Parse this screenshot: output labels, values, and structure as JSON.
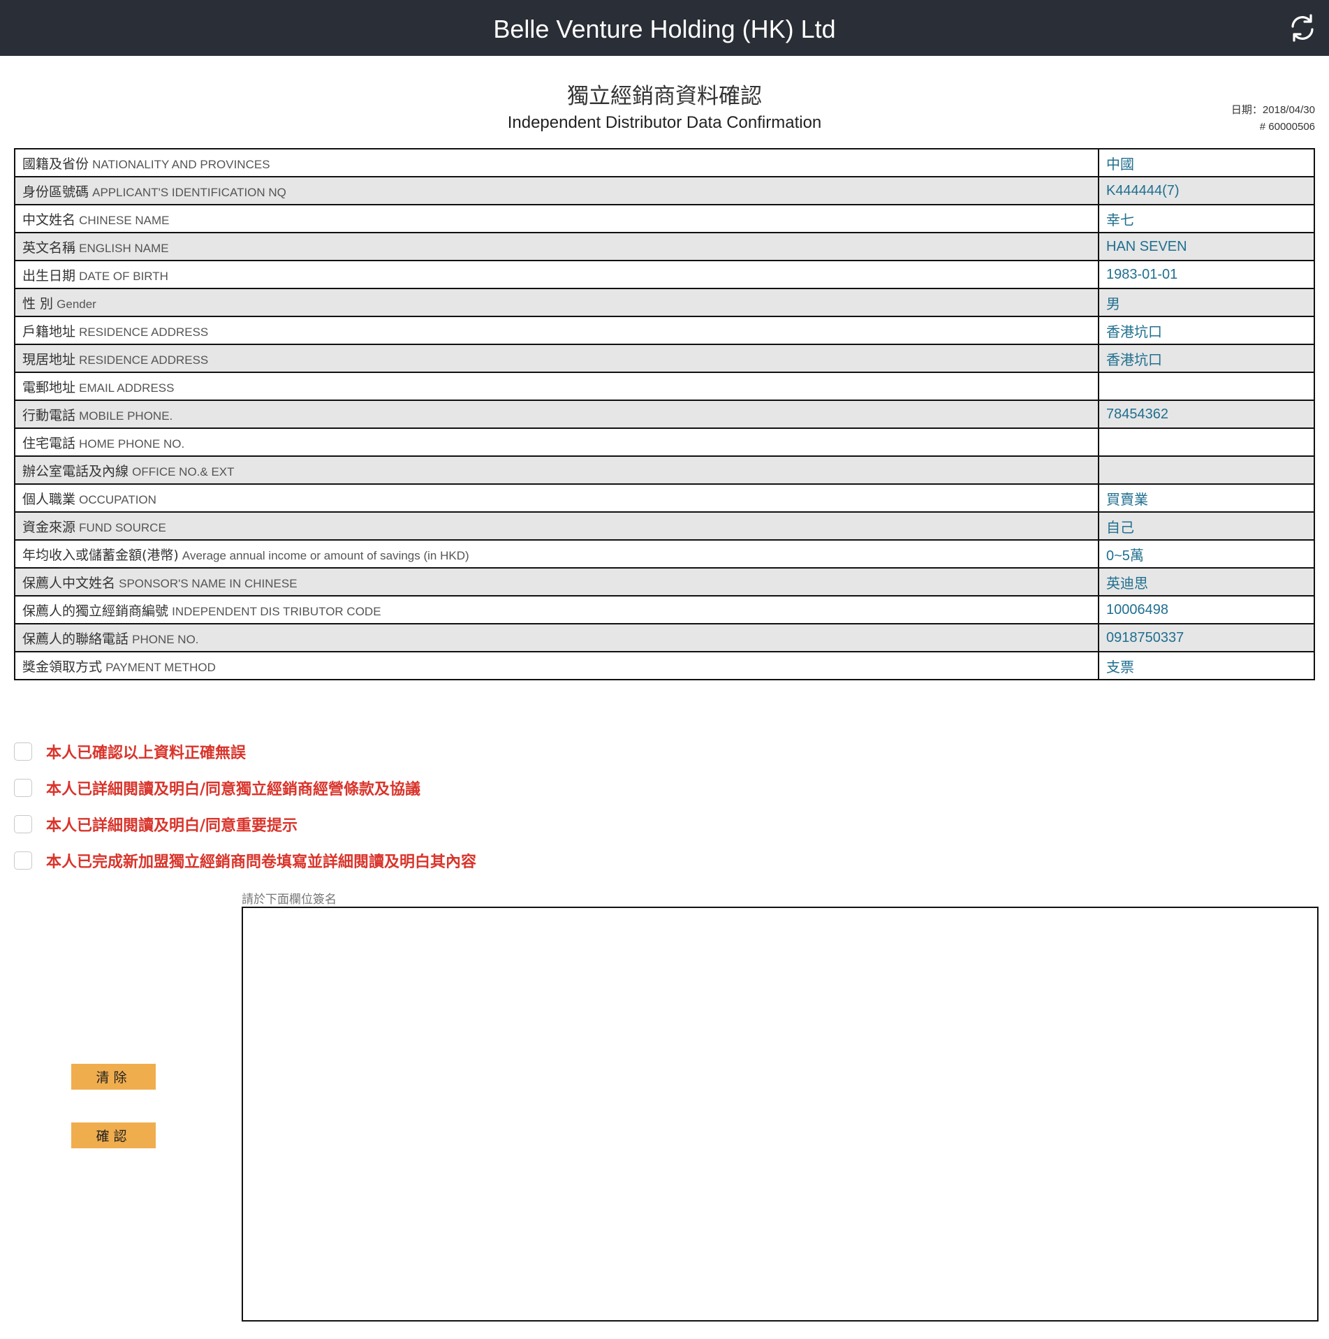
{
  "header": {
    "title": "Belle Venture Holding (HK) Ltd",
    "refresh_icon": "refresh-icon"
  },
  "document": {
    "title_cn": "獨立經銷商資料確認",
    "title_en": "Independent Distributor Data Confirmation",
    "date": "日期：2018/04/30",
    "number": "# 60000506"
  },
  "table": {
    "rows": [
      {
        "label_cn": "國籍及省份",
        "label_en": "NATIONALITY AND PROVINCES",
        "value": "中國"
      },
      {
        "label_cn": "身份區號碼",
        "label_en": "APPLICANT'S IDENTIFICATION NQ",
        "value": "K444444(7)"
      },
      {
        "label_cn": "中文姓名",
        "label_en": "CHINESE NAME",
        "value": "幸七"
      },
      {
        "label_cn": "英文名稱",
        "label_en": "ENGLISH NAME",
        "value": "HAN SEVEN"
      },
      {
        "label_cn": "出生日期",
        "label_en": "DATE OF BIRTH",
        "value": "1983-01-01"
      },
      {
        "label_cn": "性 別",
        "label_en": "Gender",
        "value": "男"
      },
      {
        "label_cn": "戶籍地址",
        "label_en": "RESIDENCE ADDRESS",
        "value": "香港坑口"
      },
      {
        "label_cn": "現居地址",
        "label_en": "RESIDENCE ADDRESS",
        "value": "香港坑口"
      },
      {
        "label_cn": "電郵地址",
        "label_en": "EMAIL ADDRESS",
        "value": ""
      },
      {
        "label_cn": "行動電話",
        "label_en": "MOBILE PHONE.",
        "value": "78454362"
      },
      {
        "label_cn": "住宅電話",
        "label_en": "HOME PHONE NO.",
        "value": ""
      },
      {
        "label_cn": "辦公室電話及內線",
        "label_en": "OFFICE NO.& EXT",
        "value": ""
      },
      {
        "label_cn": "個人職業",
        "label_en": "OCCUPATION",
        "value": "買賣業"
      },
      {
        "label_cn": "資金來源",
        "label_en": "FUND SOURCE",
        "value": "自己"
      },
      {
        "label_cn": "年均收入或儲蓄金額(港幣)",
        "label_en": "Average annual income or amount of savings (in HKD)",
        "value": "0~5萬"
      },
      {
        "label_cn": "保薦人中文姓名",
        "label_en": "SPONSOR'S NAME IN CHINESE",
        "value": "英迪思"
      },
      {
        "label_cn": "保薦人的獨立經銷商編號",
        "label_en": "INDEPENDENT DIS TRIBUTOR CODE",
        "value": "10006498"
      },
      {
        "label_cn": "保薦人的聯絡電話",
        "label_en": "PHONE NO.",
        "value": "0918750337"
      },
      {
        "label_cn": "獎金領取方式",
        "label_en": "PAYMENT METHOD",
        "value": "支票"
      }
    ]
  },
  "confirmations": [
    {
      "label": "本人已確認以上資料正確無誤",
      "checked": false
    },
    {
      "label": "本人已詳細閱讀及明白/同意獨立經銷商經營條款及協議",
      "checked": false
    },
    {
      "label": "本人已詳細閱讀及明白/同意重要提示",
      "checked": false
    },
    {
      "label": "本人已完成新加盟獨立經銷商問卷填寫並詳細閱讀及明白其內容",
      "checked": false
    }
  ],
  "signature": {
    "label": "請於下面欄位簽名"
  },
  "buttons": {
    "clear_label": "清除",
    "confirm_label": "確認"
  },
  "colors": {
    "header_bg": "#2a2e36",
    "value_text": "#1f6f8f",
    "confirm_text": "#d9342b",
    "button_bg": "#f0ad4e",
    "row_alt_bg": "#e6e6e6"
  }
}
